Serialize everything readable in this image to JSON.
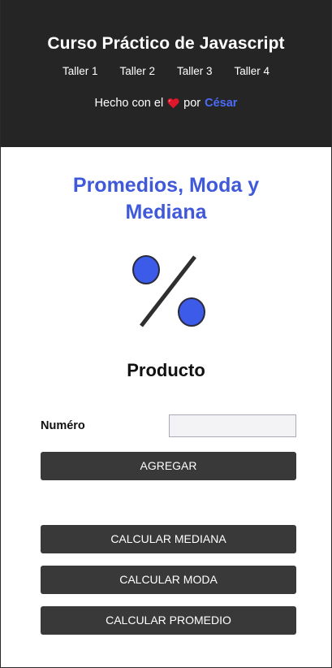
{
  "header": {
    "title": "Curso Práctico de Javascript",
    "nav": [
      {
        "label": "Taller 1"
      },
      {
        "label": "Taller 2"
      },
      {
        "label": "Taller 3"
      },
      {
        "label": "Taller 4"
      }
    ],
    "made_with_prefix": "Hecho con el",
    "made_with_by": "por",
    "author": "César"
  },
  "main": {
    "title": "Promedios, Moda y Mediana",
    "icon": "percent-icon",
    "subtitle": "Producto",
    "form": {
      "number_label": "Numéro",
      "number_value": "",
      "number_placeholder": ""
    },
    "buttons": {
      "add": "AGREGAR",
      "median": "CALCULAR MEDIANA",
      "mode": "CALCULAR MODA",
      "average": "CALCULAR PROMEDIO"
    }
  },
  "colors": {
    "header_bg": "#252525",
    "accent": "#3f59d9",
    "button_bg": "#393939"
  }
}
